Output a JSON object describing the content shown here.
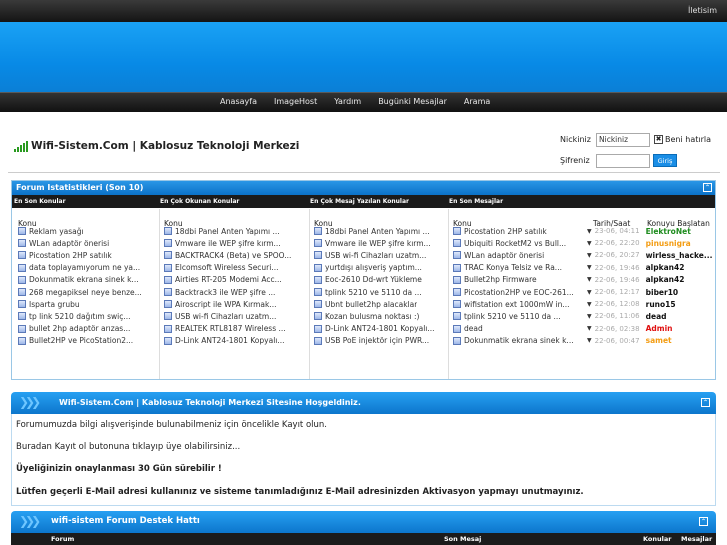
{
  "topbar": {
    "contact": "İletisim"
  },
  "nav": [
    "Anasayfa",
    "ImageHost",
    "Yardım",
    "Bugünki Mesajlar",
    "Arama"
  ],
  "site": {
    "title": "Wifi-Sistem.Com | Kablosuz Teknoloji Merkezi"
  },
  "login": {
    "username_label": "Nickiniz",
    "username_value": "Nickiniz",
    "remember": "Beni hatırla",
    "password_label": "Şifreniz",
    "submit": "Giriş"
  },
  "stats": {
    "title": "Forum Istatistikleri (Son 10)",
    "col_titles": [
      "En Son Konular",
      "En Çok Okunan Konular",
      "En Çok Mesaj Yazılan Konular",
      "En Son Mesajlar"
    ],
    "konu": "Konu",
    "tarih": "Tarih/Saat",
    "baslatan": "Konuyu Başlatan",
    "latest_topics": [
      "Reklam yasağı",
      "WLan adaptör önerisi",
      "Picostation 2HP satılık",
      "data toplayamıyorum ne ya...",
      "Dokunmatik ekrana sinek k...",
      "268 megapiksel neye benze...",
      "Isparta grubu",
      "tp link 5210 dağıtım swiç...",
      "bullet 2hp adaptör arızas...",
      "Bullet2HP ve PicoStation2..."
    ],
    "most_read": [
      "18dbi Panel Anten Yapımı ...",
      "Vmware ile WEP şifre kırm...",
      "BACKTRACK4 (Beta) ve SPOO...",
      "Elcomsoft Wireless Securi...",
      "Airties RT-205 Modemi Acc...",
      "Backtrack3 ile WEP şifre ...",
      "Airoscript ile WPA Kırmak...",
      "USB wi-fi Cihazları uzatm...",
      "REALTEK RTL8187 Wireless ...",
      "D-Link ANT24-1801 Kopyalı..."
    ],
    "most_replied": [
      "18dbi Panel Anten Yapımı ...",
      "Vmware ile WEP şifre kırm...",
      "USB wi-fi Cihazları uzatm...",
      "yurtdışı alışveriş yaptım...",
      "Eoc-2610 Dd-wrt Yükleme",
      "tplink 5210 ve 5110 da ...",
      "Ubnt bullet2hp alacaklar",
      "Kozan bulusma noktası :)",
      "D-Link ANT24-1801 Kopyalı...",
      "USB PoE injektör için PWR..."
    ],
    "latest_posts": [
      {
        "title": "Picostation 2HP satılık",
        "time": "23-06, 04:11",
        "user": "ElektroNet",
        "color": "#1e8c1e"
      },
      {
        "title": "Ubiquiti RocketM2 vs Bull...",
        "time": "22-06, 22:20",
        "user": "pinusnigra",
        "color": "#f39c12"
      },
      {
        "title": "WLan adaptör önerisi",
        "time": "22-06, 20:27",
        "user": "wirless_hacke...",
        "color": "#111111"
      },
      {
        "title": "TRAC Konya Telsiz ve Ra...",
        "time": "22-06, 19:46",
        "user": "alpkan42",
        "color": "#111111"
      },
      {
        "title": "Bullet2hp Firmware",
        "time": "22-06, 19:46",
        "user": "alpkan42",
        "color": "#111111"
      },
      {
        "title": "Picostation2HP ve EOC-261...",
        "time": "22-06, 12:17",
        "user": "biber10",
        "color": "#111111"
      },
      {
        "title": "wifistation ext 1000mW in...",
        "time": "22-06, 12:08",
        "user": "runo15",
        "color": "#111111"
      },
      {
        "title": "tplink 5210 ve 5110 da ...",
        "time": "22-06, 11:06",
        "user": "dead",
        "color": "#111111"
      },
      {
        "title": "dead",
        "time": "22-06, 02:38",
        "user": "Admin",
        "color": "#e01010"
      },
      {
        "title": "Dokunmatik ekrana sinek k...",
        "time": "22-06, 00:47",
        "user": "samet",
        "color": "#f39c12"
      }
    ]
  },
  "welcome": {
    "title": "Wifi-Sistem.Com | Kablosuz Teknoloji Merkezi Sitesine Hoşgeldiniz.",
    "lines": [
      "Forumumuzda bilgi alışverişinde bulunabilmeniz için öncelikle Kayıt olun.",
      "Buradan Kayıt ol butonuna tıklayıp üye olabilirsiniz...",
      "Üyeliğinizin onaylanması 30 Gün sürebilir !",
      "Lütfen geçerli E-Mail adresi kullanınız ve sisteme tanımladığınız E-Mail adresinizden Aktivasyon yapmayı unutmayınız."
    ]
  },
  "support": {
    "title": "wifi-sistem Forum Destek Hattı",
    "cols": [
      "Forum",
      "Son Mesaj",
      "Konular",
      "Mesajlar"
    ]
  }
}
